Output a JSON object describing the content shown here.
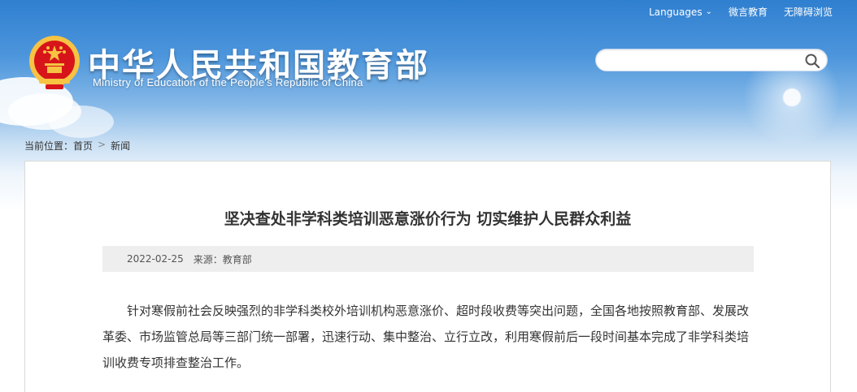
{
  "top_links": {
    "languages": "Languages",
    "weixin": "微言教育",
    "accessibility": "无障碍浏览"
  },
  "header": {
    "title_cn": "中华人民共和国教育部",
    "title_en": "Ministry of Education of the People's Republic of China"
  },
  "search": {
    "placeholder": ""
  },
  "breadcrumb": {
    "label": "当前位置：",
    "home": "首页",
    "current": "新闻"
  },
  "article": {
    "title": "坚决查处非学科类培训恶意涨价行为 切实维护人民群众利益",
    "date": "2022-02-25",
    "source": "来源：教育部",
    "paragraph": "针对寒假前社会反映强烈的非学科类校外培训机构恶意涨价、超时段收费等突出问题，全国各地按照教育部、发展改革委、市场监管总局等三部门统一部署，迅速行动、集中整治、立行立改，利用寒假前后一段时间基本完成了非学科类培训收费专项排查整治工作。"
  },
  "colors": {
    "sky_top": "#2f7fd0",
    "emblem_red": "#d7141a",
    "emblem_gold": "#f6c343"
  },
  "icons": {
    "search": "search-icon",
    "emblem": "national-emblem-icon",
    "chevron": "chevron-down-icon",
    "breadcrumb_sep": "chevron-right-icon"
  }
}
